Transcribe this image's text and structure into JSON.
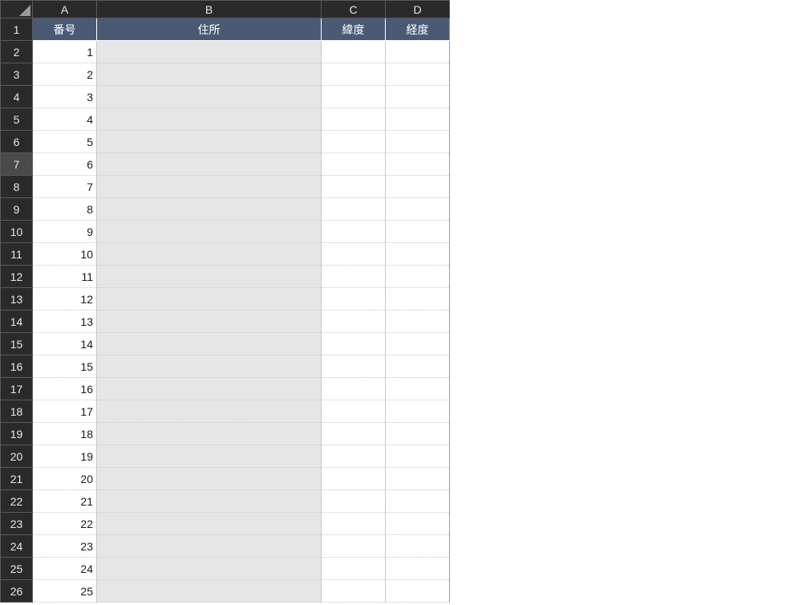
{
  "columns": [
    "A",
    "B",
    "C",
    "D"
  ],
  "rowNumbers": [
    1,
    2,
    3,
    4,
    5,
    6,
    7,
    8,
    9,
    10,
    11,
    12,
    13,
    14,
    15,
    16,
    17,
    18,
    19,
    20,
    21,
    22,
    23,
    24,
    25,
    26
  ],
  "headers": {
    "A": "番号",
    "B": "住所",
    "C": "緯度",
    "D": "経度"
  },
  "selectedRow": 7,
  "data": {
    "A": [
      1,
      2,
      3,
      4,
      5,
      6,
      7,
      8,
      9,
      10,
      11,
      12,
      13,
      14,
      15,
      16,
      17,
      18,
      19,
      20,
      21,
      22,
      23,
      24,
      25
    ]
  }
}
